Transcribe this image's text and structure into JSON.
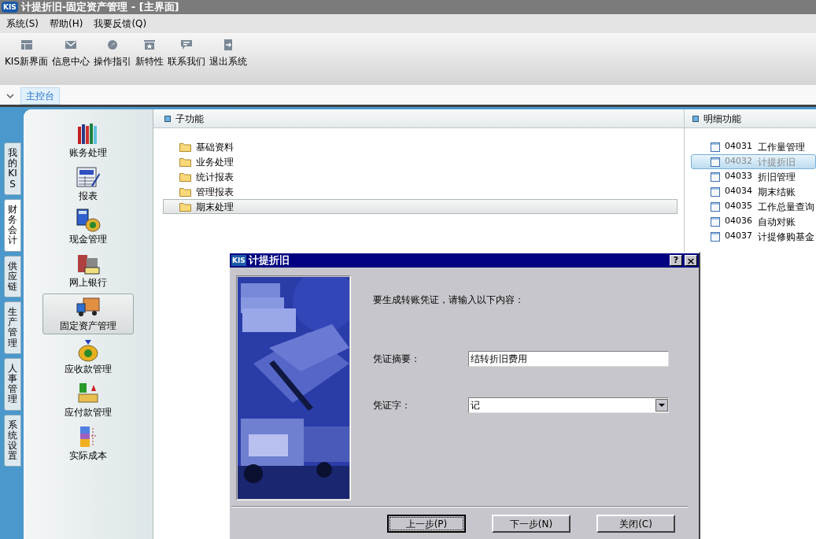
{
  "window": {
    "logo": "KIS",
    "title": "计提折旧-固定资产管理 - [主界面]"
  },
  "menu": [
    "系统(S)",
    "帮助(H)",
    "我要反馈(Q)"
  ],
  "toolbar": [
    "KIS新界面",
    "信息中心",
    "操作指引",
    "新特性",
    "联系我们",
    "退出系统"
  ],
  "tabs": [
    {
      "label": "主控台",
      "selected": true
    }
  ],
  "side_tabs": [
    {
      "label": "我的KIS",
      "selected": false
    },
    {
      "label": "财务会计",
      "selected": true
    },
    {
      "label": "供应链",
      "selected": false
    },
    {
      "label": "生产管理",
      "selected": false
    },
    {
      "label": "人事管理",
      "selected": false
    },
    {
      "label": "系统设置",
      "selected": false
    }
  ],
  "modules": [
    {
      "label": "账务处理",
      "selected": false
    },
    {
      "label": "报表",
      "selected": false
    },
    {
      "label": "现金管理",
      "selected": false
    },
    {
      "label": "网上银行",
      "selected": false
    },
    {
      "label": "固定资产管理",
      "selected": true
    },
    {
      "label": "应收款管理",
      "selected": false
    },
    {
      "label": "应付款管理",
      "selected": false
    },
    {
      "label": "实际成本",
      "selected": false
    }
  ],
  "sub_functions": {
    "title": "子功能",
    "items": [
      {
        "label": "基础资料",
        "selected": false
      },
      {
        "label": "业务处理",
        "selected": false
      },
      {
        "label": "统计报表",
        "selected": false
      },
      {
        "label": "管理报表",
        "selected": false
      },
      {
        "label": "期末处理",
        "selected": true
      }
    ]
  },
  "details": {
    "title": "明细功能",
    "items": [
      {
        "code": "04031",
        "label": "工作量管理",
        "selected": false
      },
      {
        "code": "04032",
        "label": "计提折旧",
        "selected": true
      },
      {
        "code": "04033",
        "label": "折旧管理",
        "selected": false
      },
      {
        "code": "04034",
        "label": "期末结账",
        "selected": false
      },
      {
        "code": "04035",
        "label": "工作总量查询",
        "selected": false
      },
      {
        "code": "04036",
        "label": "自动对账",
        "selected": false
      },
      {
        "code": "04037",
        "label": "计提修购基金",
        "selected": false
      }
    ]
  },
  "dialog": {
    "logo": "KIS",
    "title": "计提折旧",
    "help": "?",
    "close": "×",
    "prompt": "要生成转账凭证，请输入以下内容：",
    "summary_label": "凭证摘要：",
    "summary_value": "结转折旧费用",
    "voucher_label": "凭证字：",
    "voucher_value": "记",
    "buttons": [
      {
        "label": "上一步(P)",
        "focused": true
      },
      {
        "label": "下一步(N)",
        "focused": false
      },
      {
        "label": "关闭(C)",
        "focused": false
      }
    ]
  }
}
